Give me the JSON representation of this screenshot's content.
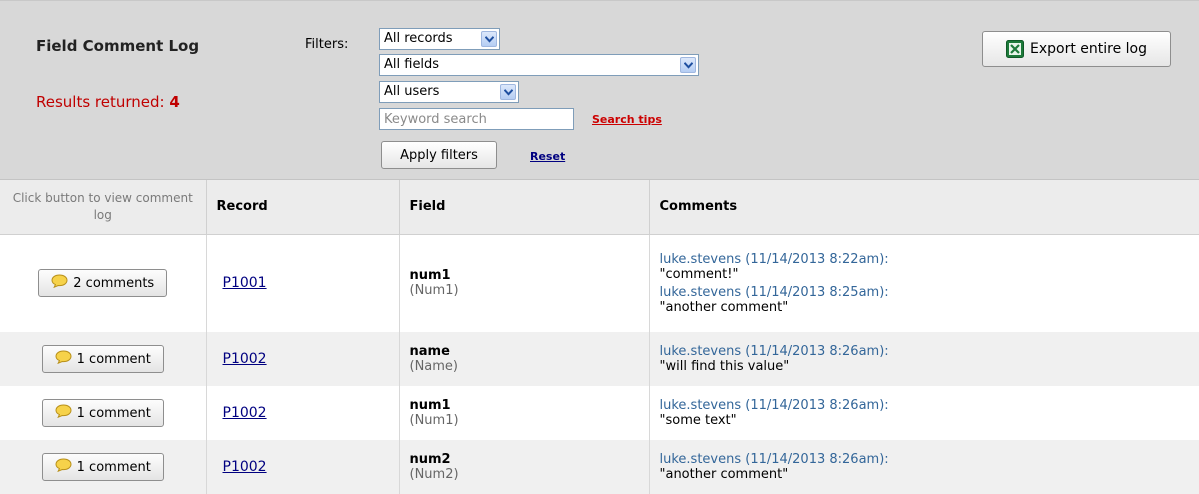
{
  "header": {
    "title": "Field Comment Log",
    "results_prefix": "Results returned:",
    "results_count": "4",
    "filters_label": "Filters:",
    "records_select": "All records",
    "fields_select": "All fields",
    "users_select": "All users",
    "keyword_placeholder": "Keyword search",
    "search_tips": "Search tips",
    "apply_label": "Apply filters",
    "reset_label": "Reset",
    "export_label": "Export entire log"
  },
  "table": {
    "headers": [
      "Click button to view comment log",
      "Record",
      "Field",
      "Comments"
    ],
    "rows": [
      {
        "button": "2 comments",
        "record": "P1001",
        "field": "num1",
        "field_label": "(Num1)",
        "comments": [
          {
            "meta": "luke.stevens (11/14/2013 8:22am):",
            "text": "\"comment!\""
          },
          {
            "meta": "luke.stevens (11/14/2013 8:25am):",
            "text": "\"another comment\""
          }
        ]
      },
      {
        "button": "1 comment",
        "record": "P1002",
        "field": "name",
        "field_label": "(Name)",
        "comments": [
          {
            "meta": "luke.stevens (11/14/2013 8:26am):",
            "text": "\"will find this value\""
          }
        ]
      },
      {
        "button": "1 comment",
        "record": "P1002",
        "field": "num1",
        "field_label": "(Num1)",
        "comments": [
          {
            "meta": "luke.stevens (11/14/2013 8:26am):",
            "text": "\"some text\""
          }
        ]
      },
      {
        "button": "1 comment",
        "record": "P1002",
        "field": "num2",
        "field_label": "(Num2)",
        "comments": [
          {
            "meta": "luke.stevens (11/14/2013 8:26am):",
            "text": "\"another comment\""
          }
        ]
      }
    ]
  },
  "colors": {
    "results": "#c00000",
    "link": "#000080",
    "comment_meta": "#336699",
    "header_bg": "#d8d8d8"
  },
  "icons": {
    "export": "excel-icon",
    "comment": "speech-bubble-icon",
    "dropdown": "chevron-down-icon"
  }
}
